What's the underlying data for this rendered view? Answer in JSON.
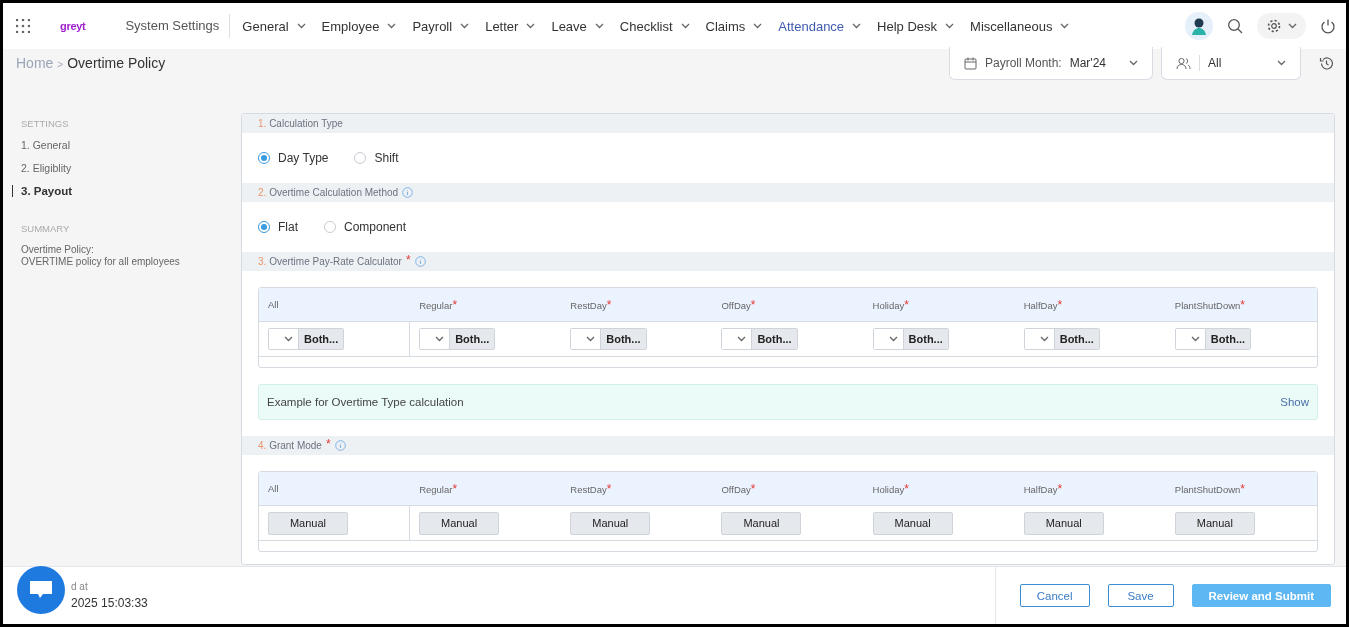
{
  "nav": {
    "logo": "greyt",
    "system_settings": "System Settings",
    "items": [
      {
        "label": "General",
        "selected": false
      },
      {
        "label": "Employee",
        "selected": false
      },
      {
        "label": "Payroll",
        "selected": false
      },
      {
        "label": "Letter",
        "selected": false
      },
      {
        "label": "Leave",
        "selected": false
      },
      {
        "label": "Checklist",
        "selected": false
      },
      {
        "label": "Claims",
        "selected": false
      },
      {
        "label": "Attendance",
        "selected": true
      },
      {
        "label": "Help Desk",
        "selected": false
      },
      {
        "label": "Miscellaneous",
        "selected": false
      }
    ]
  },
  "breadcrumb": {
    "home": "Home",
    "separator": ">",
    "current": "Overtime Policy"
  },
  "filters": {
    "payroll_month_label": "Payroll Month:",
    "payroll_month": "Mar'24",
    "employees": "All"
  },
  "sidebar": {
    "settings_heading": "SETTINGS",
    "items": [
      {
        "label": "1. General",
        "selected": false
      },
      {
        "label": "2. Eligiblity",
        "selected": false
      },
      {
        "label": "3. Payout",
        "selected": true
      }
    ],
    "summary_heading": "SUMMARY",
    "summary_title": "Overtime Policy:",
    "summary_text": "OVERTIME policy for all employees"
  },
  "sections": [
    {
      "kind": "radio",
      "number": "1.",
      "title": "Calculation Type",
      "options": [
        {
          "label": "Day Type",
          "selected": true
        },
        {
          "label": "Shift",
          "selected": false
        }
      ]
    },
    {
      "kind": "radio",
      "number": "2.",
      "title": "Overtime Calculation Method",
      "info": true,
      "options": [
        {
          "label": "Flat",
          "selected": true
        },
        {
          "label": "Component",
          "selected": false
        }
      ]
    },
    {
      "kind": "table",
      "number": "3.",
      "title": "Overtime Pay-Rate Calculator",
      "required_mark": "*",
      "info": true,
      "columns": [
        {
          "label": "All"
        },
        {
          "label": "Regular",
          "required_mark": "*"
        },
        {
          "label": "RestDay",
          "required_mark": "*"
        },
        {
          "label": "OffDay",
          "required_mark": "*"
        },
        {
          "label": "Holiday",
          "required_mark": "*"
        },
        {
          "label": "HalfDay",
          "required_mark": "*"
        },
        {
          "label": "PlantShutDown",
          "required_mark": "*"
        }
      ],
      "cells": [
        {
          "kind": "select",
          "label": "Both..."
        },
        {
          "kind": "select",
          "label": "Both..."
        },
        {
          "kind": "select",
          "label": "Both..."
        },
        {
          "kind": "select",
          "label": "Both..."
        },
        {
          "kind": "select",
          "label": "Both..."
        },
        {
          "kind": "select",
          "label": "Both..."
        },
        {
          "kind": "select",
          "label": "Both..."
        }
      ],
      "example": {
        "text": "Example for Overtime Type calculation",
        "action": "Show"
      }
    },
    {
      "kind": "table",
      "number": "4.",
      "title": "Grant Mode",
      "required_mark": "*",
      "info": true,
      "columns": [
        {
          "label": "All"
        },
        {
          "label": "Regular",
          "required_mark": "*"
        },
        {
          "label": "RestDay",
          "required_mark": "*"
        },
        {
          "label": "OffDay",
          "required_mark": "*"
        },
        {
          "label": "Holiday",
          "required_mark": "*"
        },
        {
          "label": "HalfDay",
          "required_mark": "*"
        },
        {
          "label": "PlantShutDown",
          "required_mark": "*"
        }
      ],
      "cells": [
        {
          "kind": "button",
          "label": "Manual"
        },
        {
          "kind": "button",
          "label": "Manual"
        },
        {
          "kind": "button",
          "label": "Manual"
        },
        {
          "kind": "button",
          "label": "Manual"
        },
        {
          "kind": "button",
          "label": "Manual"
        },
        {
          "kind": "button",
          "label": "Manual"
        },
        {
          "kind": "button",
          "label": "Manual"
        }
      ]
    }
  ],
  "footer": {
    "saved_label": "d at",
    "saved_time": "2025 15:03:33",
    "buttons": [
      {
        "label": "Cancel",
        "kind": "outline"
      },
      {
        "label": "Save",
        "kind": "outline"
      },
      {
        "label": "Review and Submit",
        "kind": "primary"
      }
    ]
  }
}
